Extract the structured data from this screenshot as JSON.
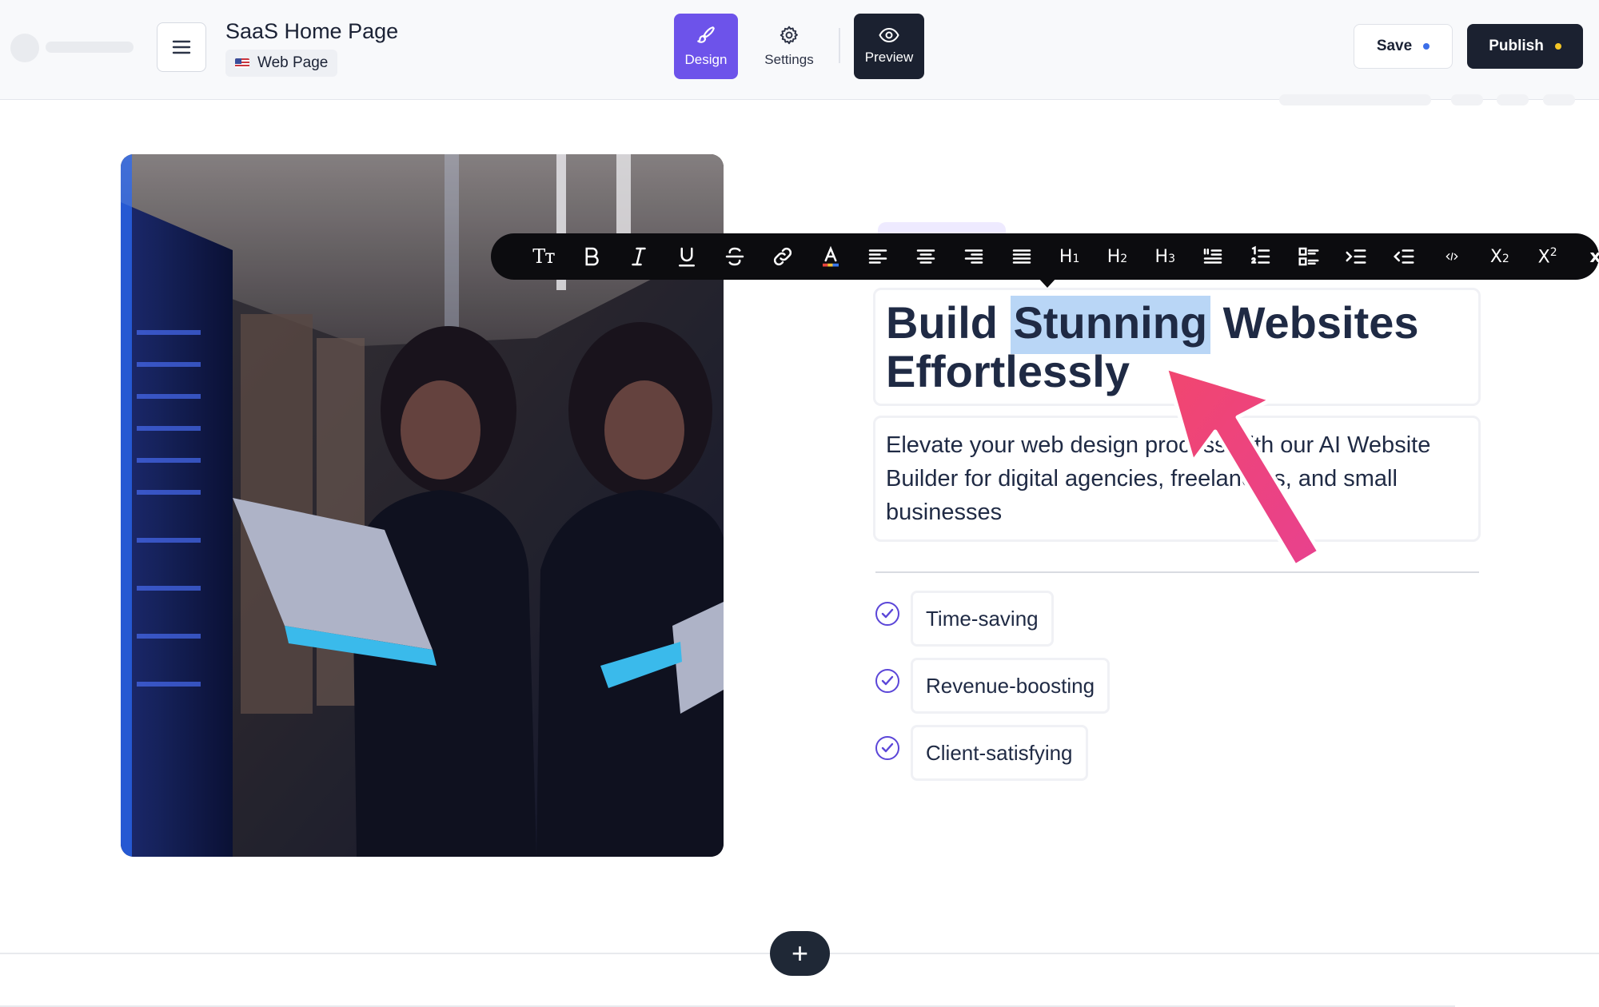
{
  "header": {
    "page_title": "SaaS Home Page",
    "page_type": "Web Page",
    "tabs": [
      {
        "label": "Design",
        "icon": "brush-icon",
        "active": true
      },
      {
        "label": "Settings",
        "icon": "gear-icon",
        "active": false
      },
      {
        "label": "Preview",
        "icon": "eye-icon",
        "active": false
      }
    ],
    "save_label": "Save",
    "publish_label": "Publish",
    "save_status_color": "#3b6ee8",
    "publish_status_color": "#f3c525"
  },
  "toolbar": {
    "items": [
      "text-size-icon",
      "bold-icon",
      "italic-icon",
      "underline-icon",
      "strikethrough-icon",
      "link-icon",
      "text-color-icon",
      "align-left-icon",
      "align-center-icon",
      "align-right-icon",
      "align-justify-icon",
      "heading-1-icon",
      "heading-2-icon",
      "heading-3-icon",
      "blockquote-icon",
      "ordered-list-icon",
      "checklist-icon",
      "indent-icon",
      "outdent-icon",
      "code-icon",
      "subscript-icon",
      "superscript-icon",
      "clear-format-icon"
    ]
  },
  "content": {
    "headline_before": "Build ",
    "headline_selected": "Stunning",
    "headline_after": " Websites Effortlessly",
    "paragraph": "Elevate your web design process with our AI Website Builder for digital agencies, freelancers, and small businesses",
    "features": [
      "Time-saving",
      "Revenue-boosting",
      "Client-satisfying"
    ]
  },
  "colors": {
    "accent": "#6d53ea",
    "dark": "#1b2130",
    "selection": "#b9d6f6",
    "arrow": "#ee3f74",
    "check": "#5b46d8"
  },
  "footer": {
    "add_label": "+"
  }
}
